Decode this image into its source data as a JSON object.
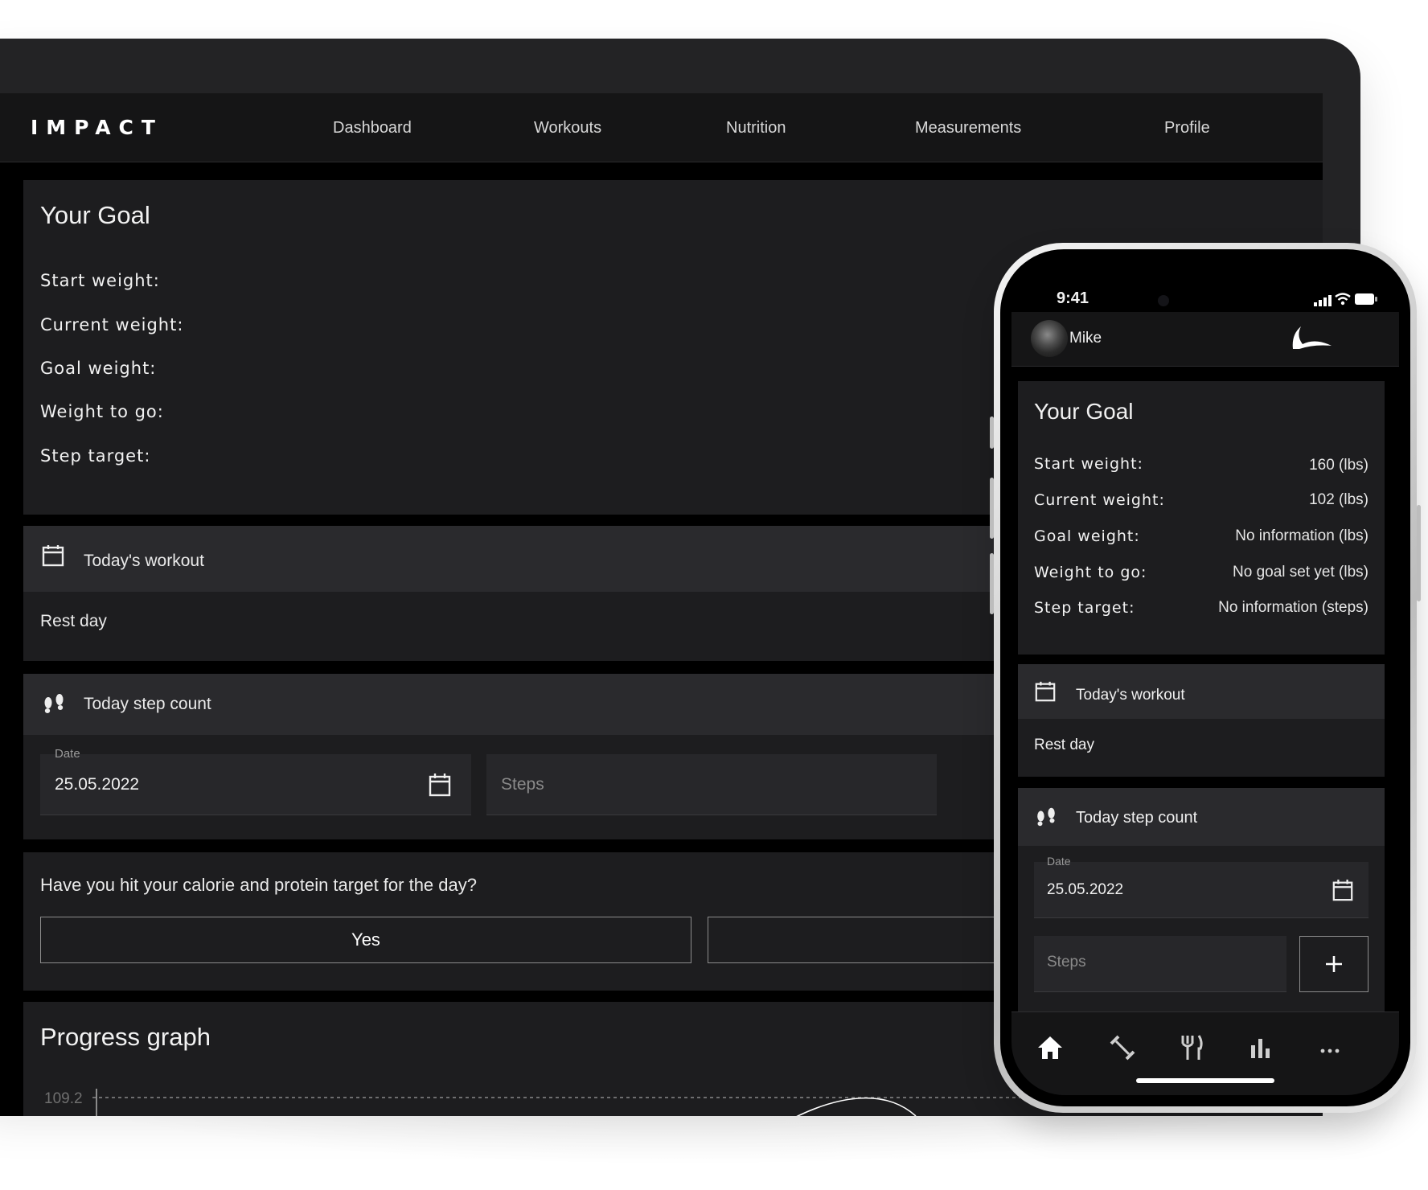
{
  "desktop": {
    "brand": "IMPACT",
    "nav": [
      "Dashboard",
      "Workouts",
      "Nutrition",
      "Measurements",
      "Profile"
    ],
    "goal": {
      "title": "Your Goal",
      "fields": [
        "Start weight:",
        "Current weight:",
        "Goal weight:",
        "Weight to go:",
        "Step target:"
      ]
    },
    "workout": {
      "title": "Today's workout",
      "value": "Rest day"
    },
    "steps": {
      "title": "Today step count",
      "date_label": "Date",
      "date_value": "25.05.2022",
      "steps_placeholder": "Steps"
    },
    "calorie": {
      "question": "Have you hit your calorie and protein target for the day?",
      "yes_label": "Yes"
    },
    "progress": {
      "title": "Progress graph",
      "axis_label": "109.2"
    }
  },
  "phone": {
    "status": {
      "time": "9:41"
    },
    "header": {
      "user_name": "Mike"
    },
    "goal": {
      "title": "Your Goal",
      "rows": [
        {
          "label": "Start weight:",
          "value": "160 (lbs)"
        },
        {
          "label": "Current weight:",
          "value": "102 (lbs)"
        },
        {
          "label": "Goal weight:",
          "value": "No information (lbs)"
        },
        {
          "label": "Weight to go:",
          "value": "No goal set yet (lbs)"
        },
        {
          "label": "Step target:",
          "value": "No information (steps)"
        }
      ]
    },
    "workout": {
      "title": "Today's workout",
      "value": "Rest day"
    },
    "steps": {
      "title": "Today step count",
      "date_label": "Date",
      "date_value": "25.05.2022",
      "steps_placeholder": "Steps"
    },
    "tabs": [
      "home-icon",
      "dumbbell-icon",
      "fork-knife-icon",
      "bar-chart-icon",
      "more-icon"
    ]
  }
}
